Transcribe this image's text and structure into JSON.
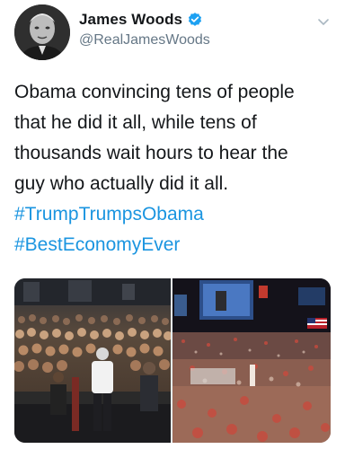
{
  "tweet": {
    "author": {
      "display_name": "James Woods",
      "handle": "@RealJamesWoods",
      "verified": true
    },
    "body_lines": [
      "Obama convincing tens of people",
      "that he did it all, while tens of",
      "thousands wait hours to hear the",
      "guy who actually did it all."
    ],
    "hashtags": [
      "#TrumpTrumpsObama",
      "#BestEconomyEver"
    ],
    "media": [
      {
        "icon": "rally-photo-obama"
      },
      {
        "icon": "rally-photo-arena"
      }
    ]
  },
  "colors": {
    "text": "#14171a",
    "secondary": "#657786",
    "link": "#1b95e0",
    "verified": "#1da1f2"
  }
}
